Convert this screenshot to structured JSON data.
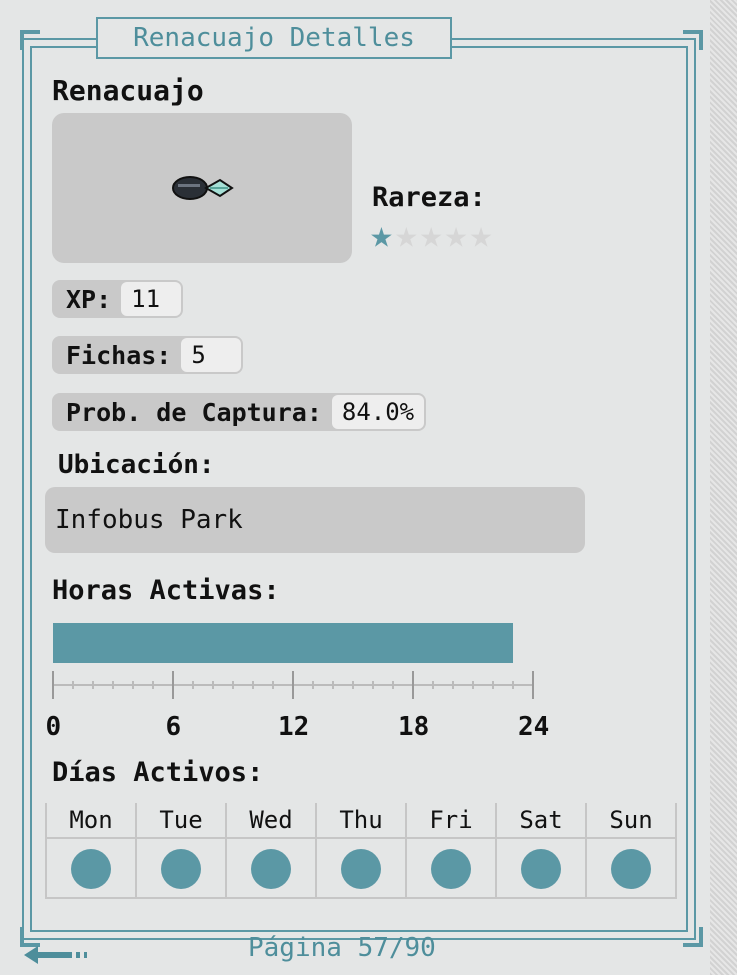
{
  "window": {
    "title": "Renacuajo Detalles"
  },
  "creature": {
    "name": "Renacuajo",
    "rarity_label": "Rareza:",
    "rarity": 1,
    "rarity_max": 5
  },
  "stats": {
    "xp_label": "XP:",
    "xp_value": "11",
    "tokens_label": "Fichas:",
    "tokens_value": "5",
    "catch_label": "Prob. de Captura:",
    "catch_value": "84.0%"
  },
  "location": {
    "label": "Ubicación:",
    "value": "Infobus Park"
  },
  "active_hours": {
    "label": "Horas Activas:",
    "start": 0,
    "end": 23,
    "ticks": [
      "0",
      "6",
      "12",
      "18",
      "24"
    ]
  },
  "active_days": {
    "label": "Días Activos:",
    "days": [
      {
        "name": "Mon",
        "active": true
      },
      {
        "name": "Tue",
        "active": true
      },
      {
        "name": "Wed",
        "active": true
      },
      {
        "name": "Thu",
        "active": true
      },
      {
        "name": "Fri",
        "active": true
      },
      {
        "name": "Sat",
        "active": true
      },
      {
        "name": "Sun",
        "active": true
      }
    ]
  },
  "footer": {
    "page_text": "Página 57/90"
  },
  "colors": {
    "accent": "#5b98a5",
    "panel": "#c9c9c9",
    "background": "#e4e6e6"
  }
}
